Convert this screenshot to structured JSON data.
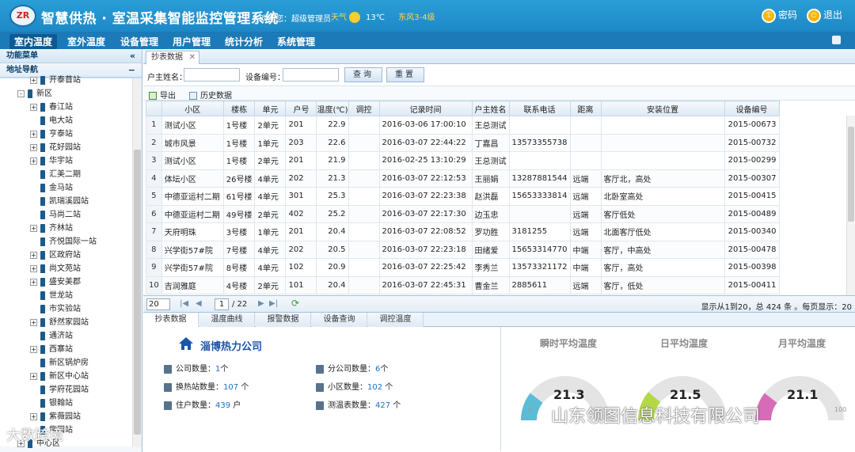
{
  "header": {
    "logo_text": "ZR",
    "title": "智慧供热 · 室温采集智能监控管理系统",
    "welcome": "欢迎您：超级管理员",
    "weather_label": "天气",
    "temperature": "13℃",
    "wind": "东风3-4级",
    "password_label": "密码",
    "logout_label": "退出",
    "accent_color": "#1e88c7"
  },
  "menu": {
    "items": [
      "室内温度",
      "室外温度",
      "设备管理",
      "用户管理",
      "统计分析",
      "系统管理"
    ]
  },
  "sidebar": {
    "title": "功能菜单",
    "section": "地址导航",
    "tree": [
      {
        "label": "开泰苜站",
        "level": 1,
        "expand": "+"
      },
      {
        "label": "新区",
        "level": 0,
        "expand": "-"
      },
      {
        "label": "春江站",
        "level": 1,
        "expand": "+"
      },
      {
        "label": "电大站",
        "level": 1,
        "expand": ""
      },
      {
        "label": "亨泰站",
        "level": 1,
        "expand": "+"
      },
      {
        "label": "花好园站",
        "level": 1,
        "expand": "+"
      },
      {
        "label": "华宇站",
        "level": 1,
        "expand": "+"
      },
      {
        "label": "汇美二期",
        "level": 1,
        "expand": ""
      },
      {
        "label": "金马站",
        "level": 1,
        "expand": ""
      },
      {
        "label": "凯瑞溪园站",
        "level": 1,
        "expand": ""
      },
      {
        "label": "马尚二站",
        "level": 1,
        "expand": ""
      },
      {
        "label": "齐林站",
        "level": 1,
        "expand": "+"
      },
      {
        "label": "齐悦国际一站",
        "level": 1,
        "expand": ""
      },
      {
        "label": "区政府站",
        "level": 1,
        "expand": "+"
      },
      {
        "label": "尚文苑站",
        "level": 1,
        "expand": "+"
      },
      {
        "label": "盛安美郡",
        "level": 1,
        "expand": "+"
      },
      {
        "label": "世龙站",
        "level": 1,
        "expand": ""
      },
      {
        "label": "市实验站",
        "level": 1,
        "expand": ""
      },
      {
        "label": "舒然家园站",
        "level": 1,
        "expand": "+"
      },
      {
        "label": "通济站",
        "level": 1,
        "expand": ""
      },
      {
        "label": "西寨站",
        "level": 1,
        "expand": "+"
      },
      {
        "label": "新区锅炉房",
        "level": 1,
        "expand": ""
      },
      {
        "label": "新区中心站",
        "level": 1,
        "expand": "+"
      },
      {
        "label": "学府花园站",
        "level": 1,
        "expand": ""
      },
      {
        "label": "银翰站",
        "level": 1,
        "expand": ""
      },
      {
        "label": "紫薇园站",
        "level": 1,
        "expand": "+"
      },
      {
        "label": "紫园站",
        "level": 1,
        "expand": ""
      },
      {
        "label": "中心区",
        "level": 0,
        "expand": "+"
      }
    ]
  },
  "main": {
    "tab": "抄表数据",
    "search": {
      "owner_label": "户主姓名：",
      "owner_value": "",
      "device_label": "设备编号：",
      "device_value": "",
      "query_button": "查询",
      "reset_button": "重置"
    },
    "toolbar": {
      "export": "导出",
      "history": "历史数据"
    },
    "columns": [
      "",
      "小区",
      "楼栋",
      "单元",
      "户号",
      "温度(℃)",
      "调控",
      "记录时间",
      "户主姓名",
      "联系电话",
      "距离",
      "安装位置",
      "设备编号"
    ],
    "rows": [
      [
        "1",
        "测试小区",
        "1号楼",
        "2单元",
        "201",
        "22.9",
        "",
        "2016-03-06 17:00:10",
        "王总测试",
        "",
        "",
        "",
        "2015-00673"
      ],
      [
        "2",
        "城市风景",
        "1号楼",
        "1单元",
        "203",
        "22.6",
        "",
        "2016-03-07 22:44:22",
        "丁嘉昌",
        "13573355738",
        "",
        "",
        "2015-00732"
      ],
      [
        "3",
        "测试小区",
        "1号楼",
        "2单元",
        "201",
        "21.9",
        "",
        "2016-02-25 13:10:29",
        "王总测试",
        "",
        "",
        "",
        "2015-00299"
      ],
      [
        "4",
        "体坛小区",
        "26号楼",
        "4单元",
        "202",
        "21.3",
        "",
        "2016-03-07 22:12:53",
        "王丽娟",
        "13287881544",
        "远端",
        "客厅北，高处",
        "2015-00307"
      ],
      [
        "5",
        "中德亚运村二期",
        "61号楼",
        "4单元",
        "301",
        "25.3",
        "",
        "2016-03-07 22:23:38",
        "赵洪磊",
        "15653333814",
        "远端",
        "北卧室高处",
        "2015-00415"
      ],
      [
        "6",
        "中德亚运村二期",
        "49号楼",
        "2单元",
        "402",
        "25.2",
        "",
        "2016-03-07 22:17:30",
        "边玉忠",
        "",
        "远端",
        "客厅低处",
        "2015-00489"
      ],
      [
        "7",
        "天府明珠",
        "3号楼",
        "1单元",
        "201",
        "20.4",
        "",
        "2016-03-07 22:08:52",
        "罗功胜",
        "3181255",
        "远端",
        "北面客厅低处",
        "2015-00340"
      ],
      [
        "8",
        "兴学街57#院",
        "7号楼",
        "4单元",
        "202",
        "20.5",
        "",
        "2016-03-07 22:23:18",
        "田绪爱",
        "15653314770",
        "中端",
        "客厅，中高处",
        "2015-00478"
      ],
      [
        "9",
        "兴学街57#院",
        "8号楼",
        "4单元",
        "102",
        "20.9",
        "",
        "2016-03-07 22:25:42",
        "李秀兰",
        "13573321172",
        "中端",
        "客厅，高处",
        "2015-00398"
      ],
      [
        "10",
        "吉润雅庭",
        "4号楼",
        "2单元",
        "101",
        "20.4",
        "",
        "2016-03-07 22:45:31",
        "曹金兰",
        "2885611",
        "远端",
        "客厅，低处",
        "2015-00411"
      ]
    ],
    "pager": {
      "page_size": "20",
      "current_page": "1",
      "total_pages": "/ 22",
      "info": "显示从1到20，总 424 条 。每页显示：20"
    },
    "bottom_tabs": [
      "抄表数据",
      "温度曲线",
      "报警数据",
      "设备查询",
      "调控温度"
    ],
    "company": {
      "name": "淄博热力公司",
      "stats": [
        {
          "label": "公司数量：",
          "value": "1",
          "unit": "个"
        },
        {
          "label": "分公司数量：",
          "value": "6",
          "unit": "个"
        },
        {
          "label": "换热站数量：",
          "value": "107",
          "unit": " 个"
        },
        {
          "label": "小区数量：",
          "value": "102",
          "unit": " 个"
        },
        {
          "label": "住户数量：",
          "value": "439",
          "unit": " 户"
        },
        {
          "label": "测温表数量：",
          "value": "427",
          "unit": " 个"
        }
      ]
    },
    "gauges": [
      {
        "title": "瞬时平均温度",
        "value": "21.3",
        "level": 0.21,
        "color": "#5bbcd6",
        "min": "0"
      },
      {
        "title": "日平均温度",
        "value": "21.5",
        "level": 0.22,
        "color": "#b5d84a",
        "min": ""
      },
      {
        "title": "月平均温度",
        "value": "21.1",
        "level": 0.21,
        "color": "#d66bb8",
        "min": ""
      }
    ],
    "gauge_max_label": "100"
  },
  "watermarks": [
    "山东领图信息科技有限公司",
    "大数跨境"
  ]
}
